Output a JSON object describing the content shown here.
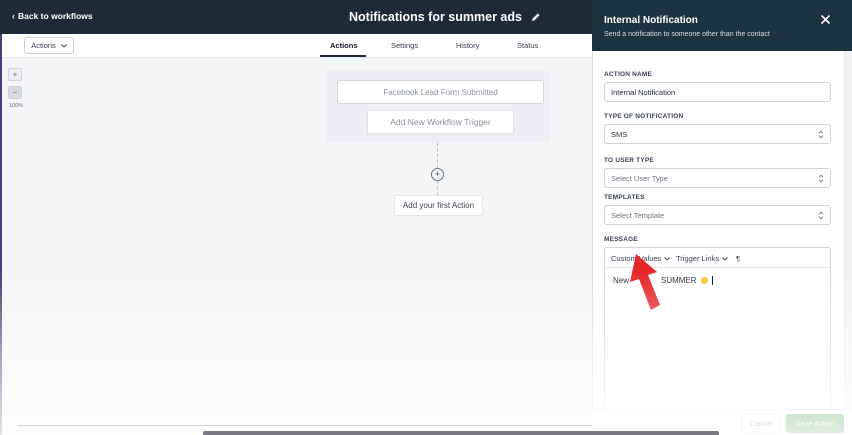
{
  "header": {
    "back_label": "Back to workflows",
    "workflow_title": "Notifications for summer ads"
  },
  "toolbar": {
    "actions_dropdown": "Actions",
    "tabs": [
      {
        "label": "Actions",
        "active": true
      },
      {
        "label": "Settings",
        "active": false
      },
      {
        "label": "History",
        "active": false
      },
      {
        "label": "Status",
        "active": false
      }
    ]
  },
  "zoom": {
    "plus": "+",
    "minus": "−",
    "level": "100%"
  },
  "canvas": {
    "trigger": "Facebook Lead Form Submitted",
    "add_trigger": "Add New Workflow Trigger",
    "add_action_symbol": "+",
    "first_action": "Add your first Action"
  },
  "drawer": {
    "title": "Internal Notification",
    "subtitle": "Send a notification to someone other than the contact",
    "fields": {
      "action_name": {
        "label": "ACTION NAME",
        "value": "Internal Notification"
      },
      "notification_type": {
        "label": "TYPE OF NOTIFICATION",
        "value": "SMS"
      },
      "user_type": {
        "label": "TO USER TYPE",
        "placeholder": "Select User Type"
      },
      "templates": {
        "label": "TEMPLATES",
        "placeholder": "Select Template"
      },
      "message": {
        "label": "MESSAGE",
        "toolbar": [
          "Custom Values",
          "Trigger Links",
          "¶"
        ],
        "text_start": "New",
        "text_end": "SUMMER"
      }
    },
    "footer": {
      "cancel": "Cancel",
      "save": "Save Action"
    }
  },
  "colors": {
    "header_dark": "#1e2a38",
    "drawer_header": "#1e3340",
    "save_green": "#2f8f3a",
    "annotation_red": "#e5252a"
  }
}
